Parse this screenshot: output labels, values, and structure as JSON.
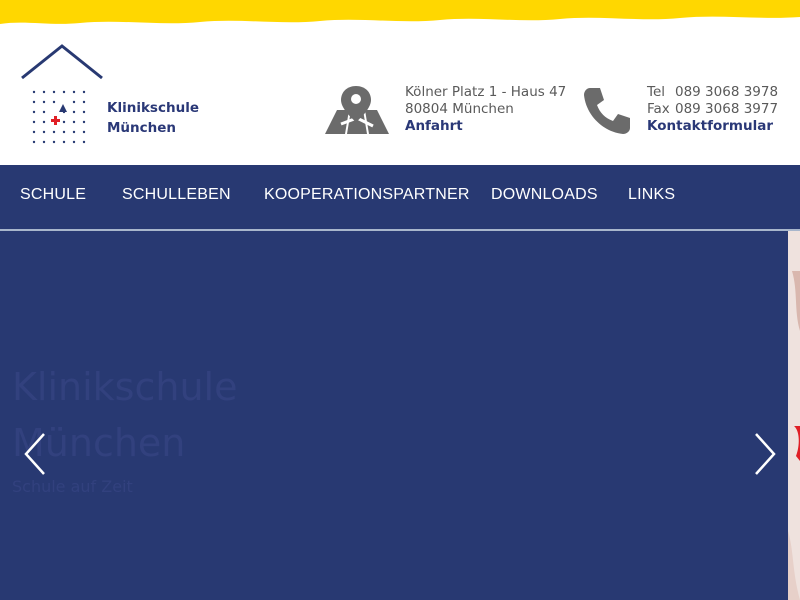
{
  "colors": {
    "brand_blue": "#283972",
    "accent_yellow": "#ffd700",
    "accent_red": "#e01f26",
    "text_gray": "#5a5a5a"
  },
  "logo": {
    "line1": "Klinikschule",
    "line2": "München",
    "icon": "house-dots-logo-icon"
  },
  "address": {
    "icon": "map-pin-icon",
    "line1": "Kölner Platz 1 - Haus 47",
    "line2": "80804 München",
    "link": "Anfahrt"
  },
  "contact": {
    "icon": "phone-icon",
    "tel_label": "Tel",
    "tel": "089 3068 3978",
    "fax_label": "Fax",
    "fax": "089 3068 3977",
    "link": "Kontaktformular"
  },
  "nav": {
    "items": [
      {
        "label": "SCHULE"
      },
      {
        "label": "SCHULLEBEN"
      },
      {
        "label": "KOOPERATIONSPARTNER"
      },
      {
        "label": "DOWNLOADS"
      },
      {
        "label": "LINKS"
      }
    ]
  },
  "hero": {
    "title_line1": "Klinikschule",
    "title_line2": "München",
    "subtitle": "Schule auf Zeit",
    "prev_icon": "chevron-left-icon",
    "next_icon": "chevron-right-icon"
  }
}
